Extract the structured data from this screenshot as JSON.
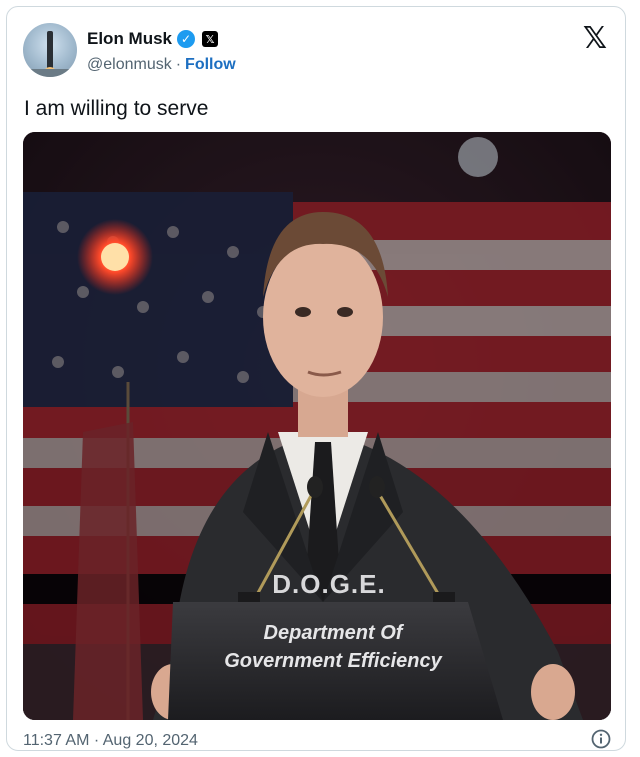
{
  "author": {
    "display_name": "Elon Musk",
    "handle": "@elonmusk",
    "separator": "·",
    "follow_label": "Follow",
    "verified_icon": "verified-badge-icon",
    "affiliation_icon": "x-affiliation-icon"
  },
  "tweet": {
    "text": "I am willing to serve",
    "timestamp": "11:37 AM · Aug 20, 2024"
  },
  "media": {
    "podium_heading": "D.O.G.E.",
    "podium_line1": "Department Of",
    "podium_line2": "Government Efficiency"
  },
  "colors": {
    "follow": "#1d6fc1",
    "verified": "#1d9bf0",
    "muted_text": "#536471",
    "flag_red": "#b5262e",
    "flag_blue": "#1f2c4d"
  }
}
